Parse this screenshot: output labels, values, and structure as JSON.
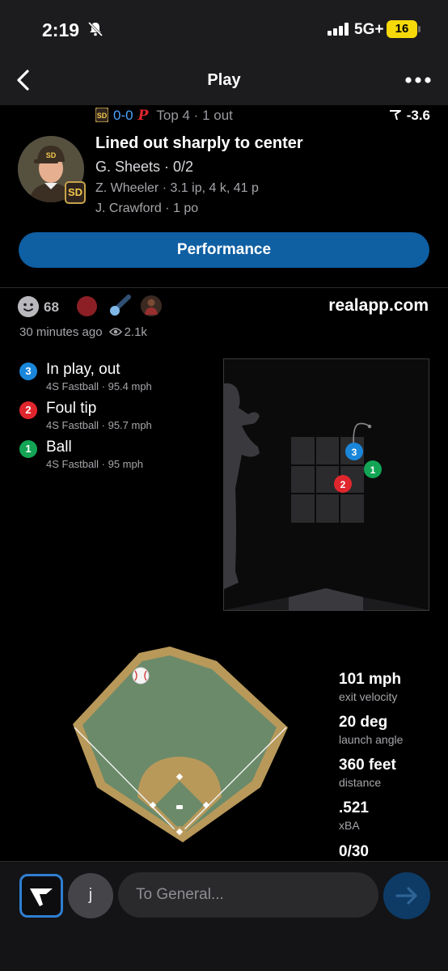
{
  "status_bar": {
    "time": "2:19",
    "network": "5G+",
    "battery": "16"
  },
  "nav": {
    "title": "Play"
  },
  "game": {
    "score": "0-0",
    "inning": "Top 4 · 1 out",
    "win_prob": "-3.6"
  },
  "play": {
    "title": "Lined out sharply to center",
    "batter": "G. Sheets · 0/2",
    "pitcher": "Z. Wheeler · 3.1 ip, 4 k, 41 p",
    "fielder": "J. Crawford · 1 po",
    "team_badge": "SD"
  },
  "performance_button": "Performance",
  "reactions": {
    "count": "68"
  },
  "watermark": "realapp.com",
  "meta": {
    "posted": "30 minutes ago",
    "views": "2.1k"
  },
  "pitches": [
    {
      "num": "3",
      "color": "#1a86d9",
      "result": "In play, out",
      "detail": "4S Fastball · 95.4 mph"
    },
    {
      "num": "2",
      "color": "#e0262d",
      "result": "Foul tip",
      "detail": "4S Fastball · 95.7 mph"
    },
    {
      "num": "1",
      "color": "#13a555",
      "result": "Ball",
      "detail": "4S Fastball · 95 mph"
    }
  ],
  "stats": [
    {
      "value": "101 mph",
      "label": "exit velocity"
    },
    {
      "value": "20 deg",
      "label": "launch angle"
    },
    {
      "value": "360 feet",
      "label": "distance"
    },
    {
      "value": ".521",
      "label": "xBA"
    },
    {
      "value": "0/30",
      "label": ""
    }
  ],
  "composer": {
    "avatar_letter": "j",
    "placeholder": "To General..."
  },
  "colors": {
    "accent": "#0f5fa3",
    "field_grass": "#6b8a6a",
    "field_dirt": "#b8995a"
  }
}
